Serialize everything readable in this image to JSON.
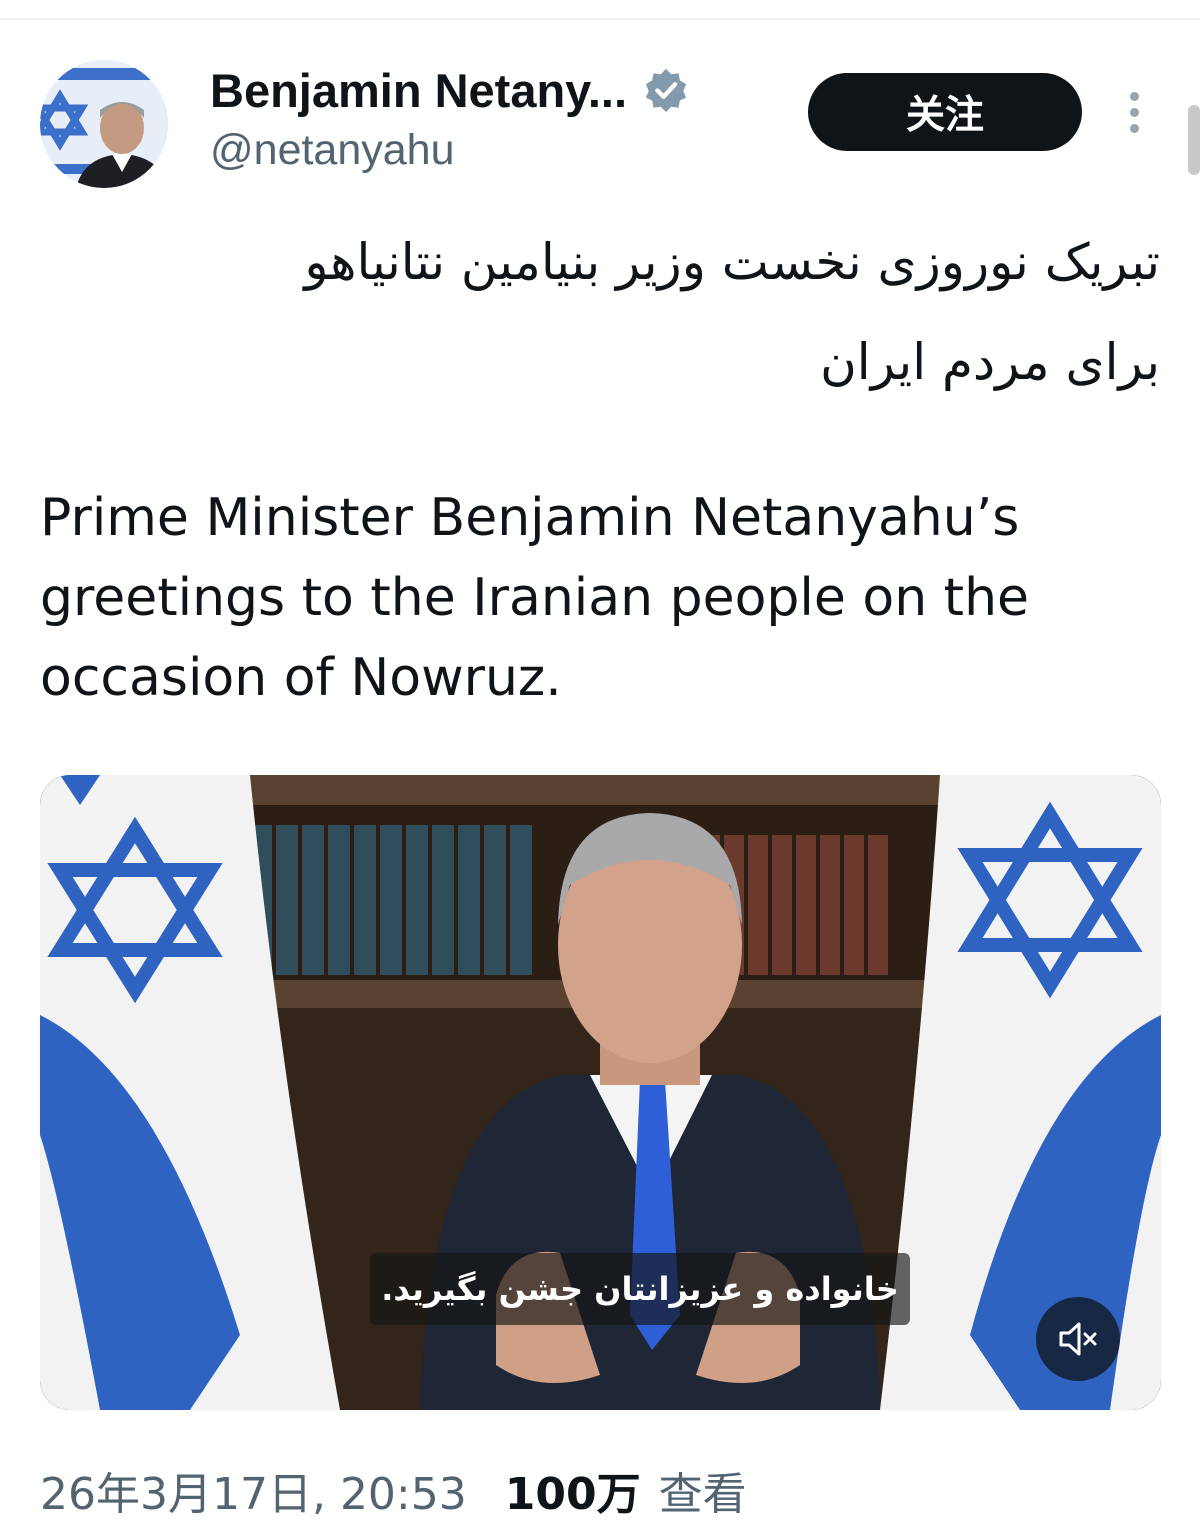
{
  "author": {
    "display_name": "Benjamin Netany...",
    "handle": "@netanyahu",
    "verified": true
  },
  "actions": {
    "follow_label": "关注"
  },
  "post": {
    "text_persian": "تبریک نوروزی نخست وزیر بنیامین نتانیاهو\nبرای مردم ایران",
    "text_english": "Prime Minister Benjamin Netanyahu’s greetings to the Iranian people on the occasion of Nowruz.",
    "media": {
      "type": "video",
      "caption": "خانواده و عزیزانتان جشن بگیرید.",
      "muted": true
    }
  },
  "meta": {
    "timestamp": "26年3月17日, 20:53",
    "views": "100万",
    "views_label": "查看"
  },
  "icons": {
    "verified": "verified-badge-icon",
    "more": "more-vertical-icon",
    "mute": "speaker-muted-icon"
  },
  "colors": {
    "primary_text": "#0f1419",
    "secondary_text": "#536471",
    "follow_bg": "#0f1419",
    "verified": "#829aab",
    "flag_blue": "#2f63c2"
  }
}
